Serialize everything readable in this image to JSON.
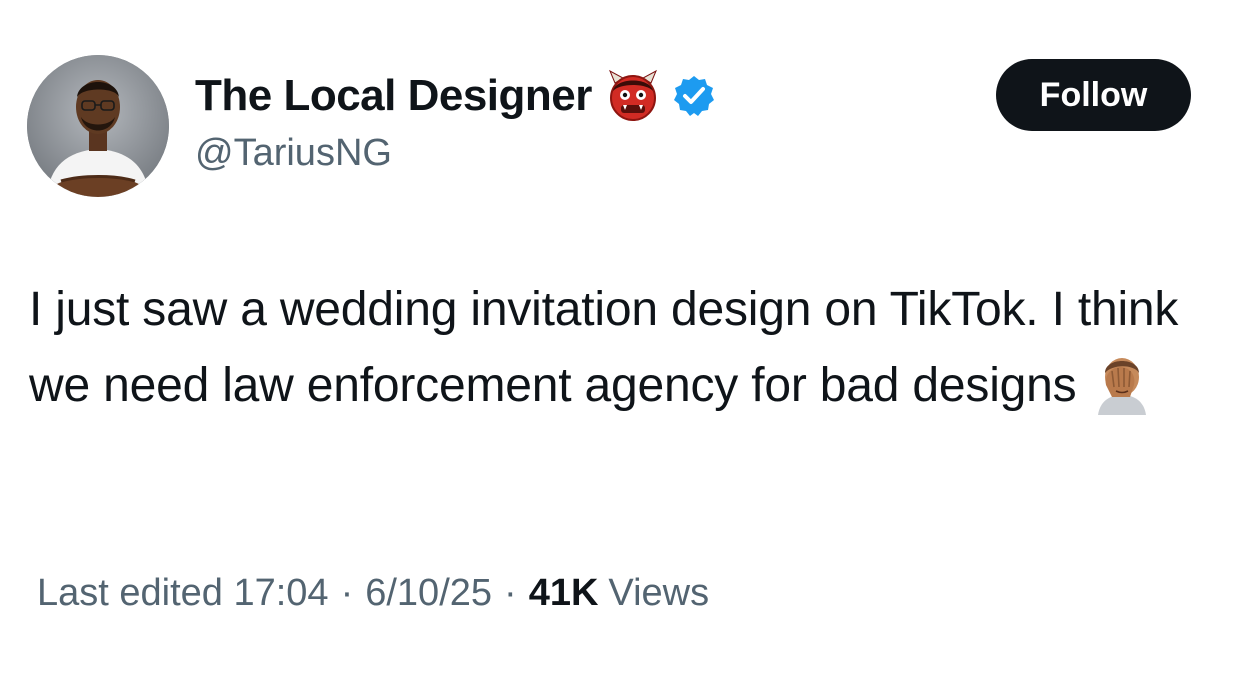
{
  "author": {
    "display_name": "The Local Designer",
    "name_emoji": "japanese-ogre-emoji",
    "verified": true,
    "handle": "@TariusNG",
    "avatar": "profile-photo"
  },
  "follow_label": "Follow",
  "tweet": {
    "text": "I just saw a wedding invitation design on TikTok. I think we need law enforcement agency for bad designs",
    "trailing_emoji": "person-facepalming-emoji"
  },
  "meta": {
    "edited_label": "Last edited 17:04",
    "date": "6/10/25",
    "separator": "·",
    "views_count": "41K",
    "views_label": "Views"
  },
  "colors": {
    "text_primary": "#0f1419",
    "text_secondary": "#536471",
    "verified_blue": "#1d9bf0",
    "follow_bg": "#0f1419"
  }
}
